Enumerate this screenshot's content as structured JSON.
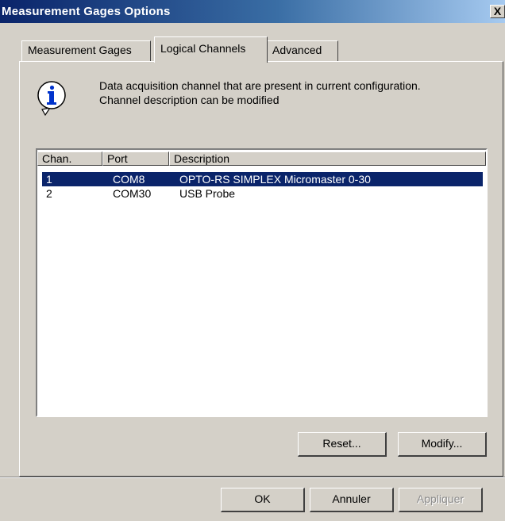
{
  "window": {
    "title": "Measurement Gages Options",
    "close_label": "X"
  },
  "tabs": [
    {
      "label": "Measurement Gages",
      "active": false
    },
    {
      "label": "Logical Channels",
      "active": true
    },
    {
      "label": "Advanced",
      "active": false
    }
  ],
  "info": {
    "icon": "info-icon",
    "line1": "Data acquisition channel that are present in current configuration.",
    "line2": "Channel description can be modified"
  },
  "table": {
    "columns": [
      "Chan.",
      "Port",
      "Description"
    ],
    "rows": [
      {
        "chan": "1",
        "port": "COM8",
        "description": "OPTO-RS SIMPLEX Micromaster 0-30",
        "selected": true
      },
      {
        "chan": "2",
        "port": "COM30",
        "description": "USB Probe",
        "selected": false
      }
    ]
  },
  "panel_buttons": {
    "reset": "Reset...",
    "modify": "Modify..."
  },
  "dialog_buttons": {
    "ok": "OK",
    "cancel": "Annuler",
    "apply": "Appliquer"
  },
  "colors": {
    "selection": "#0a246a",
    "title_start": "#0a246a",
    "title_end": "#a6caf0",
    "face": "#d4d0c8"
  }
}
